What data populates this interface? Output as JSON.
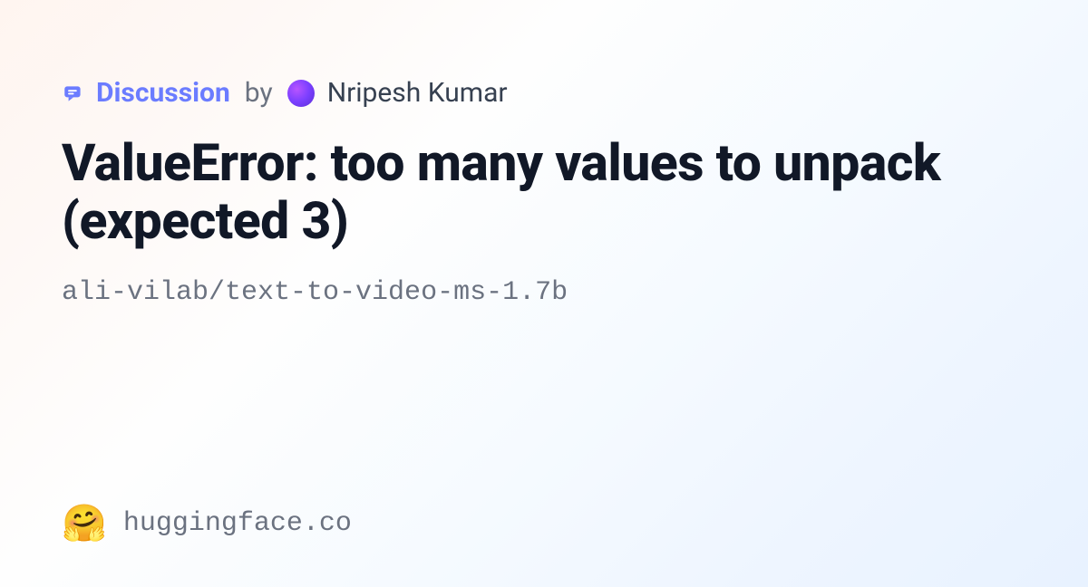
{
  "header": {
    "discussion_label": "Discussion",
    "by_text": "by",
    "author_name": "Nripesh Kumar"
  },
  "title": "ValueError: too many values to unpack (expected 3)",
  "repo_path": "ali-vilab/text-to-video-ms-1.7b",
  "footer": {
    "logo_emoji": "🤗",
    "site": "huggingface.co"
  }
}
